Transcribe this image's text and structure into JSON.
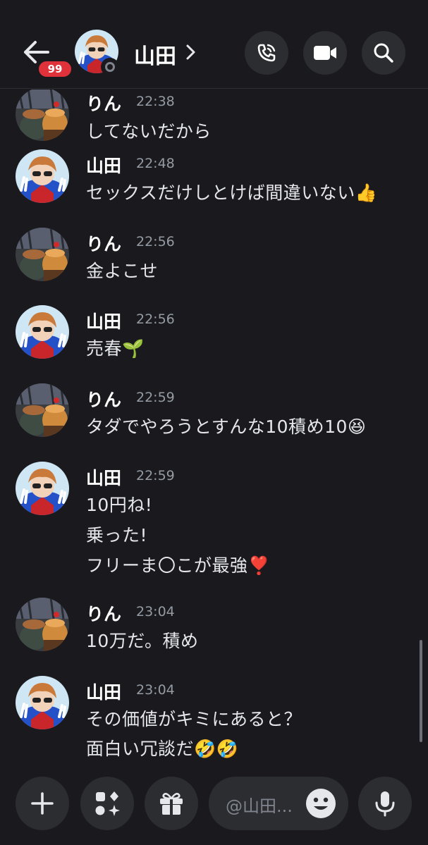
{
  "header": {
    "badge_count": "99",
    "title": "山田",
    "icons": {
      "back": "arrow-left-icon",
      "chevron": "chevron-right-icon",
      "call": "phone-call-icon",
      "video": "video-camera-icon",
      "search": "search-icon"
    },
    "status": "offline"
  },
  "messages": [
    {
      "author": "りん",
      "time": "22:38",
      "lines": [
        "してないだから"
      ]
    },
    {
      "author": "山田",
      "time": "22:48",
      "lines": [
        "セックスだけしとけば間違いない👍"
      ]
    },
    {
      "author": "りん",
      "time": "22:56",
      "lines": [
        "金よこせ"
      ]
    },
    {
      "author": "山田",
      "time": "22:56",
      "lines": [
        "売春🌱"
      ]
    },
    {
      "author": "りん",
      "time": "22:59",
      "lines": [
        "タダでやろうとすんな10積め10😆"
      ]
    },
    {
      "author": "山田",
      "time": "22:59",
      "lines": [
        "10円ね!",
        "乗った!",
        "フリーま〇こが最強❣️"
      ]
    },
    {
      "author": "りん",
      "time": "23:04",
      "lines": [
        "10万だ。積め"
      ]
    },
    {
      "author": "山田",
      "time": "23:04",
      "lines": [
        "その価値がキミにあると？",
        "面白い冗談だ🤣🤣"
      ]
    }
  ],
  "composer": {
    "placeholder": "@山田...",
    "icons": {
      "plus": "plus-icon",
      "apps": "apps-sparkle-icon",
      "gift": "gift-icon",
      "emoji": "emoji-icon",
      "mic": "microphone-icon"
    }
  },
  "colors": {
    "background": "#1a1a1e",
    "surface": "#2b2d31",
    "badge": "#e0323a",
    "timestamp": "#949ba4"
  }
}
